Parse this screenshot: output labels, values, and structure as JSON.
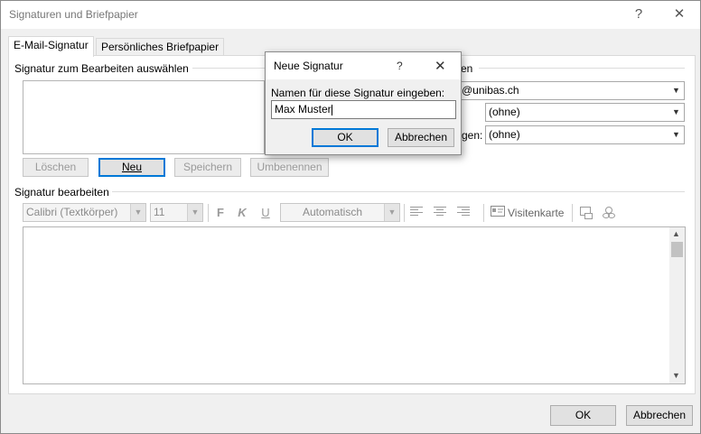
{
  "window": {
    "title": "Signaturen und Briefpapier",
    "help": "?",
    "close": "✕"
  },
  "tabs": [
    {
      "label": "E-Mail-Signatur",
      "active": true
    },
    {
      "label": "Persönliches Briefpapier",
      "active": false
    }
  ],
  "select_group": {
    "label": "Signatur zum Bearbeiten auswählen"
  },
  "default_group": {
    "account_value": "@unibas.ch",
    "new_messages_label_tail": "",
    "new_messages_value": "(ohne)",
    "replies_label_tail": "gen:",
    "replies_value": "(ohne)",
    "group_label_tail": "en"
  },
  "sig_buttons": {
    "delete": "Löschen",
    "new": "Neu",
    "save": "Speichern",
    "rename": "Umbenennen"
  },
  "edit_group": {
    "label": "Signatur bearbeiten",
    "font": "Calibri (Textkörper)",
    "size": "11",
    "bold": "F",
    "italic": "K",
    "underline": "U",
    "color": "Automatisch",
    "business_card": "Visitenkarte"
  },
  "footer": {
    "ok": "OK",
    "cancel": "Abbrechen"
  },
  "dialog": {
    "title": "Neue Signatur",
    "help": "?",
    "close": "✕",
    "prompt": "Namen für diese Signatur eingeben:",
    "input_value": "Max Muster",
    "ok": "OK",
    "cancel": "Abbrechen"
  },
  "colors": {
    "accent": "#0078d7",
    "window_bg": "#f0f0f0",
    "disabled_text": "#9a9a9a"
  }
}
